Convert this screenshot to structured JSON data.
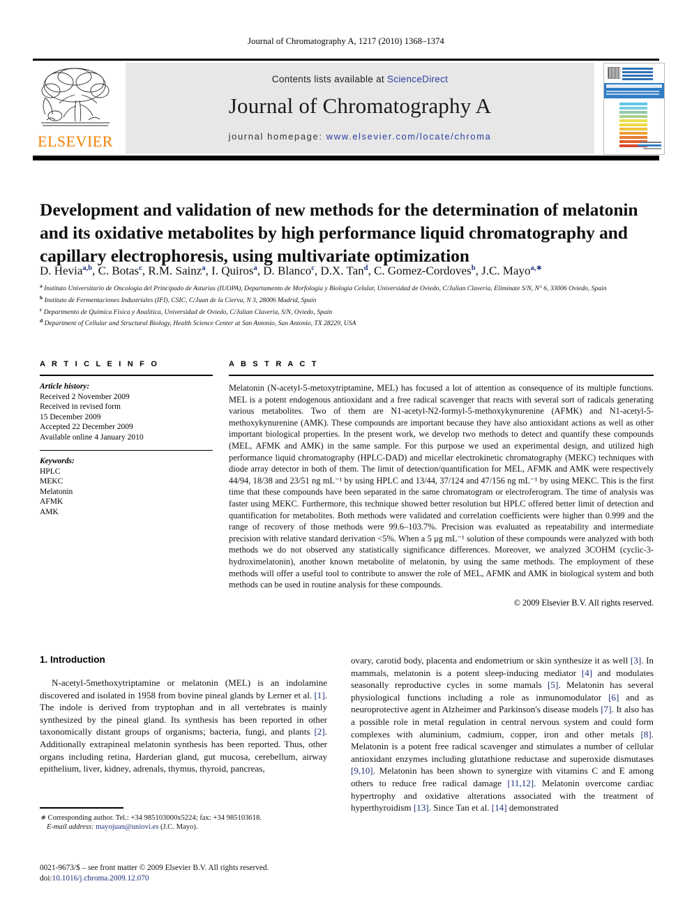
{
  "running_head": "Journal of Chromatography A, 1217 (2010) 1368–1374",
  "masthead": {
    "contents_prefix": "Contents lists available at ",
    "contents_link": "ScienceDirect",
    "journal_title": "Journal of Chromatography A",
    "homepage_prefix": "journal homepage: ",
    "homepage_url": "www.elsevier.com/locate/chroma",
    "publisher_wordmark": "ELSEVIER",
    "cover_title": "JOURNAL OF CHROMATOGRAPHY A",
    "accent_orange": "#F08000",
    "link_blue": "#2b3f9e",
    "cover_blue": "#2f7dc4"
  },
  "article": {
    "title": "Development and validation of new methods for the determination of melatonin and its oxidative metabolites by high performance liquid chromatography and capillary electrophoresis, using multivariate optimization",
    "authors_html": "D. Hevia<sup>a,b</sup>, C. Botas<sup>c</sup>, R.M. Sainz<sup>a</sup>, I. Quiros<sup>a</sup>, D. Blanco<sup>c</sup>, D.X. Tan<sup>d</sup>, C. Gomez-Cordoves<sup>b</sup>, J.C. Mayo<sup>a,<span class=\"star\">∗</span></sup>",
    "affiliations": [
      {
        "mark": "a",
        "text": "Instituto Universitario de Oncologia del Principado de Asturias (IUOPA), Departamento de Morfologia y Biologia Celular, Universidad de Oviedo, C/Julian Claveria, Eliminate S/N, N° 6, 33006 Oviedo, Spain"
      },
      {
        "mark": "b",
        "text": "Instituto de Fermentaciones Industriales (IFI), CSIC, C/Juan de la Cierva, N 3, 28006 Madrid, Spain"
      },
      {
        "mark": "c",
        "text": "Departmento de Química Fisica y Analitica, Universidad de Oviedo, C/Julian Claveria, S/N, Oviedo, Spain"
      },
      {
        "mark": "d",
        "text": "Department of Cellular and Structural Biology, Health Science Center at San Antonio, San Antonio, TX 28229, USA"
      }
    ]
  },
  "article_info": {
    "heading": "A R T I C L E  I N F O",
    "history_label": "Article history:",
    "history": [
      "Received 2 November 2009",
      "Received in revised form",
      "15 December 2009",
      "Accepted 22 December 2009",
      "Available online 4 January 2010"
    ],
    "keywords_label": "Keywords:",
    "keywords": [
      "HPLC",
      "MEKC",
      "Melatonin",
      "AFMK",
      "AMK"
    ]
  },
  "abstract": {
    "heading": "A B S T R A C T",
    "text": "Melatonin (N-acetyl-5-metoxytriptamine, MEL) has focused a lot of attention as consequence of its multiple functions. MEL is a potent endogenous antioxidant and a free radical scavenger that reacts with several sort of radicals generating various metabolites. Two of them are N1-acetyl-N2-formyl-5-methoxykynurenine (AFMK) and N1-acetyl-5-methoxykynurenine (AMK). These compounds are important because they have also antioxidant actions as well as other important biological properties. In the present work, we develop two methods to detect and quantify these compounds (MEL, AFMK and AMK) in the same sample. For this purpose we used an experimental design, and utilized high performance liquid chromatography (HPLC-DAD) and micellar electrokinetic chromatography (MEKC) techniques with diode array detector in both of them. The limit of detection/quantification for MEL, AFMK and AMK were respectively 44/94, 18/38 and 23/51 ng mL⁻¹ by using HPLC and 13/44, 37/124 and 47/156 ng mL⁻¹ by using MEKC. This is the first time that these compounds have been separated in the same chromatogram or electroferogram. The time of analysis was faster using MEKC. Furthermore, this technique showed better resolution but HPLC offered better limit of detection and quantification for metabolites. Both methods were validated and correlation coefficients were higher than 0.999 and the range of recovery of those methods were 99.6–103.7%. Precision was evaluated as repeatability and intermediate precision with relative standard derivation <5%. When a 5 μg mL⁻¹ solution of these compounds were analyzed with both methods we do not observed any statistically significance differences. Moreover, we analyzed 3COHM (cyclic-3-hydroximelatonin), another known metabolite of melatonin, by using the same methods. The employment of these methods will offer a useful tool to contribute to answer the role of MEL, AFMK and AMK in biological system and both methods can be used in routine analysis for these compounds.",
    "copyright": "© 2009 Elsevier B.V. All rights reserved."
  },
  "body": {
    "section_heading": "1.  Introduction",
    "left_paragraph_html": "N-acetyl-5methoxytriptamine or melatonin (MEL) is an indolamine discovered and isolated in 1958 from bovine pineal glands by Lerner et al. <span class=\"ref\">[1]</span>. The indole is derived from tryptophan and in all vertebrates is mainly synthesized by the pineal gland. Its synthesis has been reported in other taxonomically distant groups of organisms; bacteria, fungi, and plants <span class=\"ref\">[2]</span>. Additionally extrapineal melatonin synthesis has been reported. Thus, other organs including retina, Harderian gland, gut mucosa, cerebellum, airway epithelium, liver, kidney, adrenals, thymus, thyroid, pancreas,",
    "right_paragraph_html": "ovary, carotid body, placenta and endometrium or skin synthesize it as well <span class=\"ref\">[3]</span>. In mammals, melatonin is a potent sleep-inducing mediator <span class=\"ref\">[4]</span> and modulates seasonally reproductive cycles in some mamals <span class=\"ref\">[5]</span>. Melatonin has several physiological functions including a role as inmunomodulator <span class=\"ref\">[6]</span> and as neuroprotective agent in Alzheimer and Parkinson's disease models <span class=\"ref\">[7]</span>. It also has a possible role in metal regulation in central nervous system and could form complexes with aluminium, cadmium, copper, iron and other metals <span class=\"ref\">[8]</span>. Melatonin is a potent free radical scavenger and stimulates a number of cellular antioxidant enzymes including glutathione reductase and superoxide dismutases <span class=\"ref\">[9,10]</span>. Melatonin has been shown to synergize with vitamins C and E among others to reduce free radical damage <span class=\"ref\">[11,12]</span>. Melatonin overcome cardiac hypertrophy and oxidative alterations associated with the treatment of hyperthyroidism <span class=\"ref\">[13]</span>. Since Tan et al. <span class=\"ref\">[14]</span> demonstrated"
  },
  "footnote": {
    "corresponding_html": "<span class=\"fn-ital\">∗</span> Corresponding author. Tel.: +34 985103000x5224; fax: +34 985103618.",
    "email_html": "<span class=\"fn-ital\">E-mail address:</span> <span class=\"mail-link\">mayojuan@uniovi.es</span> (J.C. Mayo)."
  },
  "imprint": {
    "line1": "0021-9673/$ – see front matter © 2009 Elsevier B.V. All rights reserved.",
    "doi_prefix": "doi:",
    "doi": "10.1016/j.chroma.2009.12.070"
  }
}
